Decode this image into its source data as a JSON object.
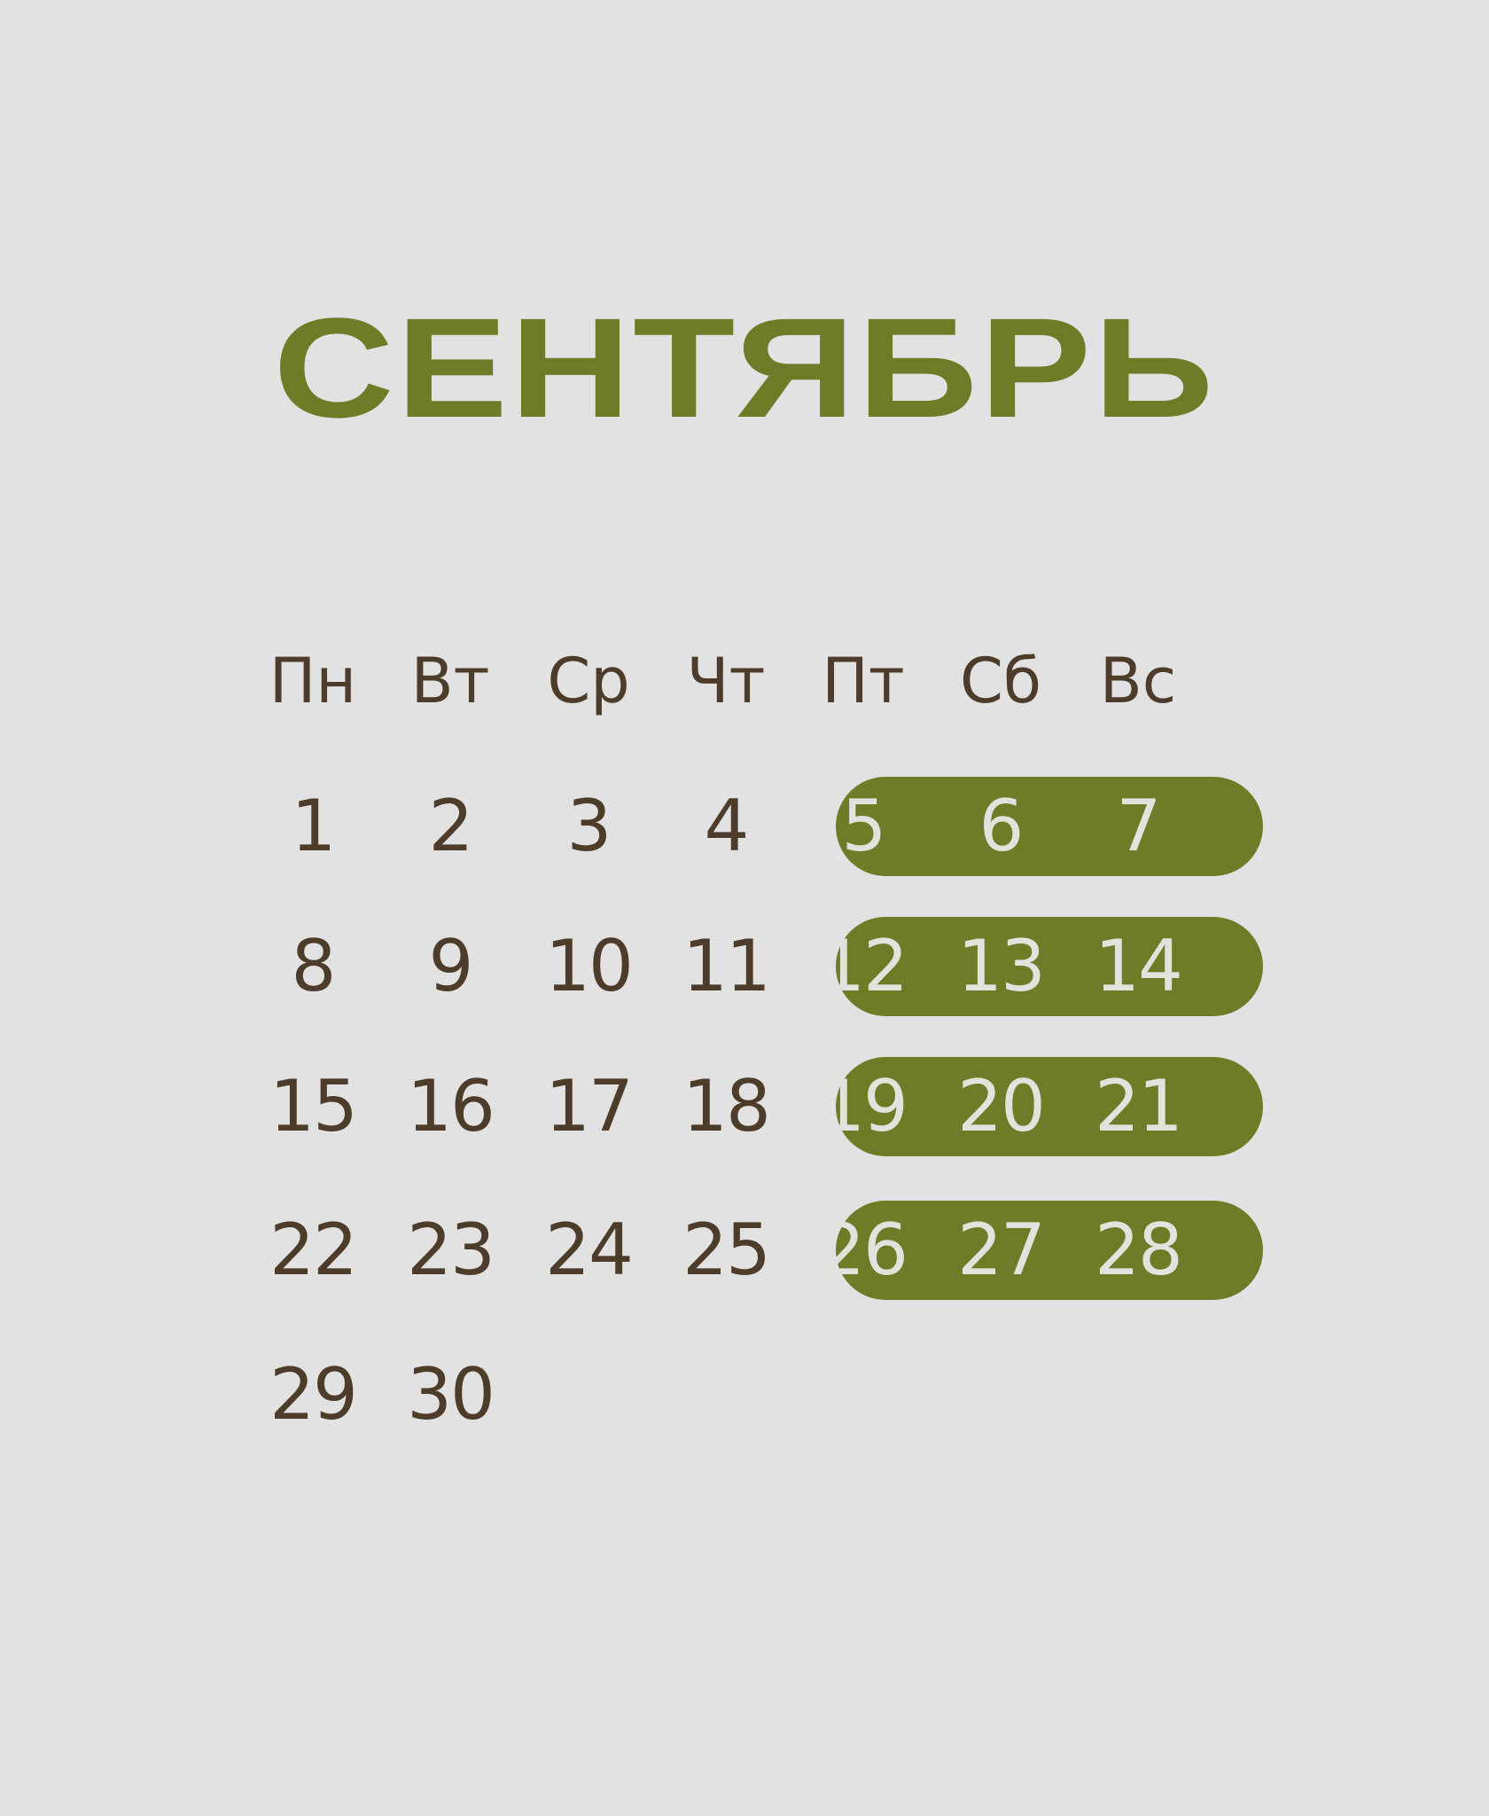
{
  "month": "СЕНТЯБРЬ",
  "weekdays": [
    "Пн",
    "Вт",
    "Ср",
    "Чт",
    "Пт",
    "Сб",
    "Вс"
  ],
  "weeks": [
    [
      "1",
      "2",
      "3",
      "4",
      "5",
      "6",
      "7"
    ],
    [
      "8",
      "9",
      "10",
      "11",
      "12",
      "13",
      "14"
    ],
    [
      "15",
      "16",
      "17",
      "18",
      "19",
      "20",
      "21"
    ],
    [
      "22",
      "23",
      "24",
      "25",
      "26",
      "27",
      "28"
    ],
    [
      "29",
      "30",
      "",
      "",
      "",
      "",
      ""
    ]
  ],
  "highlighted_columns": [
    "Пт",
    "Сб",
    "Вс"
  ],
  "colors": {
    "background": "#e2e2e2",
    "accent": "#6e7c28",
    "text": "#4e3c2b",
    "highlight_text": "#e4e2dc"
  }
}
